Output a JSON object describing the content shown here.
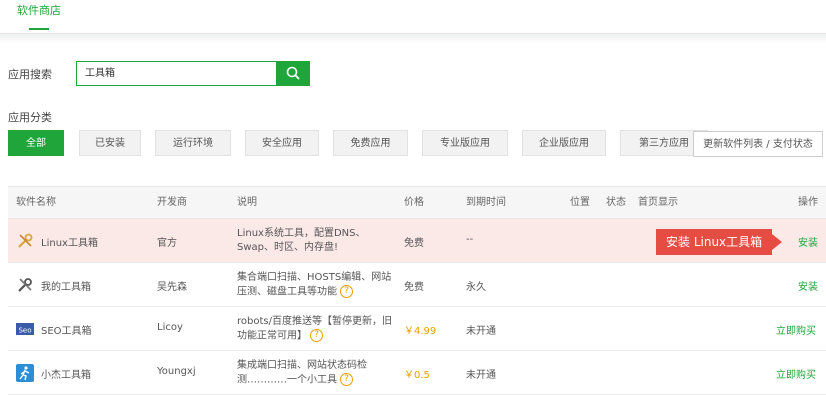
{
  "tabs": {
    "active": "软件商店"
  },
  "search": {
    "label": "应用搜索",
    "value": "工具箱"
  },
  "categories": {
    "label": "应用分类",
    "items": [
      "全部",
      "已安装",
      "运行环境",
      "安全应用",
      "免费应用",
      "专业版应用",
      "企业版应用",
      "第三方应用"
    ],
    "active": "全部",
    "refresh_label": "更新软件列表 / 支付状态"
  },
  "table": {
    "headers": {
      "name": "软件名称",
      "developer": "开发商",
      "desc": "说明",
      "price": "价格",
      "expire": "到期时间",
      "position": "位置",
      "status": "状态",
      "home": "首页显示",
      "op": "操作"
    },
    "rows": [
      {
        "icon": "linux-toolbox-icon",
        "name": "Linux工具箱",
        "developer": "官方",
        "desc": "Linux系统工具，配置DNS、Swap、时区、内存盘!",
        "price": "免费",
        "expire": "--",
        "action": "安装",
        "highlight": true,
        "tooltip": "安装 Linux工具箱"
      },
      {
        "icon": "wrench-tools-icon",
        "name": "我的工具箱",
        "developer": "吴先森",
        "desc": "集合端口扫描、HOSTS编辑、网站压测、磁盘工具等功能",
        "price": "免费",
        "expire": "永久",
        "action": "安装"
      },
      {
        "icon": "seo-icon",
        "name": "SEO工具箱",
        "developer": "Licoy",
        "desc": "robots/百度推送等【暂停更新，旧功能正常可用】",
        "price": "￥4.99",
        "expire": "未开通",
        "action": "立即购买"
      },
      {
        "icon": "runner-icon",
        "name": "小杰工具箱",
        "developer": "Youngxj",
        "desc": "集成端口扫描、网站状态码检测…………一个小工具",
        "price": "￥0.5",
        "expire": "未开通",
        "action": "立即购买"
      }
    ]
  },
  "colors": {
    "accent": "#20a53a",
    "danger": "#e54d42",
    "price": "#e6a100",
    "highlight_row": "#fbe9e8"
  }
}
